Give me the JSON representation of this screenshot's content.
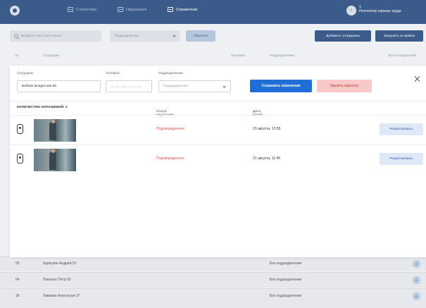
{
  "nav": {
    "items": [
      {
        "label": "Статистика",
        "active": false
      },
      {
        "label": "Нарушения",
        "active": false
      },
      {
        "label": "Справочник",
        "active": true
      }
    ],
    "user": {
      "avatar_letter": "I",
      "number": "1",
      "role": "Инспектор охраны труда"
    }
  },
  "toolbar": {
    "search_placeholder": "Введите текст для поиска",
    "department_placeholder": "Подразделение",
    "reset_label": "Сбросить",
    "add_label": "Добавить сотрудника",
    "upload_label": "Загрузить из файла"
  },
  "table": {
    "headers": {
      "id": "ID",
      "employee": "Сотрудник",
      "phone": "Телефон",
      "department": "Подразделение",
      "violations": "Всего нарушений"
    },
    "rows": [
      {
        "id": "55",
        "name": "Карпухин Андрей 51",
        "department": "Без подразделения",
        "count": "0"
      },
      {
        "id": "64",
        "name": "Ловыгин Пётр 59",
        "department": "Без подразделения",
        "count": "0"
      },
      {
        "id": "39",
        "name": "Лаврова Анастасия 37",
        "department": "Без подразделения",
        "count": "0"
      }
    ]
  },
  "card": {
    "employee_label": "Сотрудник",
    "employee_value": "Бабаян Владислав 68",
    "phone_label": "Телефон",
    "phone_placeholder": "___ (___) ___-__-__",
    "department_label": "Подразделение",
    "department_placeholder": "Подразделение",
    "save_label": "Сохранить изменения",
    "delete_label": "Удалить карточку",
    "violations_count_label": "КОЛИЧЕСТВО НАРУШЕНИЙ: 2",
    "status_header": "Статус нарушения",
    "status_sort": "↑↓",
    "datetime_header": "Дата, время",
    "datetime_sort": "↓",
    "violations": [
      {
        "status": "Подтвержденное",
        "datetime": "21 августа, 12:55",
        "edit_label": "Редактировать"
      },
      {
        "status": "Подтвержденное",
        "datetime": "21 августа, 11:45",
        "edit_label": "Редактировать"
      }
    ]
  },
  "colors": {
    "primary": "#3b5b8a",
    "accent": "#1f6fd6",
    "danger": "#e0524d"
  }
}
